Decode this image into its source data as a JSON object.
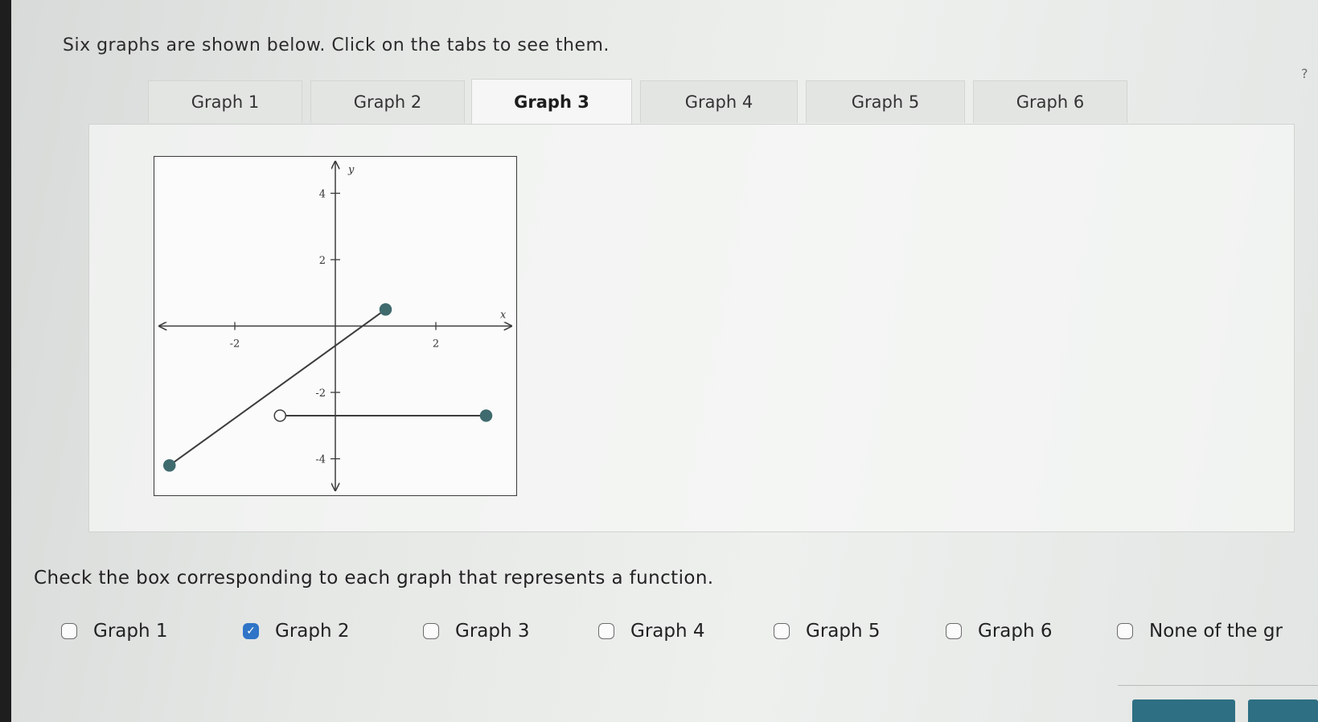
{
  "prompt": "Six graphs are shown below. Click on the tabs to see them.",
  "tabs": [
    {
      "label": "Graph 1",
      "active": false
    },
    {
      "label": "Graph 2",
      "active": false
    },
    {
      "label": "Graph 3",
      "active": true
    },
    {
      "label": "Graph 4",
      "active": false
    },
    {
      "label": "Graph 5",
      "active": false
    },
    {
      "label": "Graph 6",
      "active": false
    }
  ],
  "help_icon": "?",
  "graph": {
    "x_label": "x",
    "y_label": "y",
    "x_ticks": [
      "-2",
      "2"
    ],
    "y_ticks": [
      "4",
      "2",
      "-2",
      "-4"
    ]
  },
  "chart_data": {
    "type": "line",
    "xlim": [
      -3.6,
      3.6
    ],
    "ylim": [
      -5.1,
      5.1
    ],
    "grid": false,
    "segments": [
      {
        "from": [
          -3.3,
          -4.2
        ],
        "to": [
          1.0,
          0.5
        ],
        "from_filled": true,
        "to_filled": true
      },
      {
        "from": [
          -1.1,
          -2.7
        ],
        "to": [
          3.0,
          -2.7
        ],
        "from_filled": false,
        "to_filled": true
      }
    ]
  },
  "question": "Check the box corresponding to each graph that represents a function.",
  "options": [
    {
      "label": "Graph 1",
      "checked": false
    },
    {
      "label": "Graph 2",
      "checked": true
    },
    {
      "label": "Graph 3",
      "checked": false
    },
    {
      "label": "Graph 4",
      "checked": false
    },
    {
      "label": "Graph 5",
      "checked": false
    },
    {
      "label": "Graph 6",
      "checked": false
    },
    {
      "label": "None of the gr",
      "checked": false
    }
  ],
  "colors": {
    "point": "#3f6a6e",
    "line": "#3c3c3c",
    "check": "#2f74c7",
    "button": "#2e6f83"
  }
}
